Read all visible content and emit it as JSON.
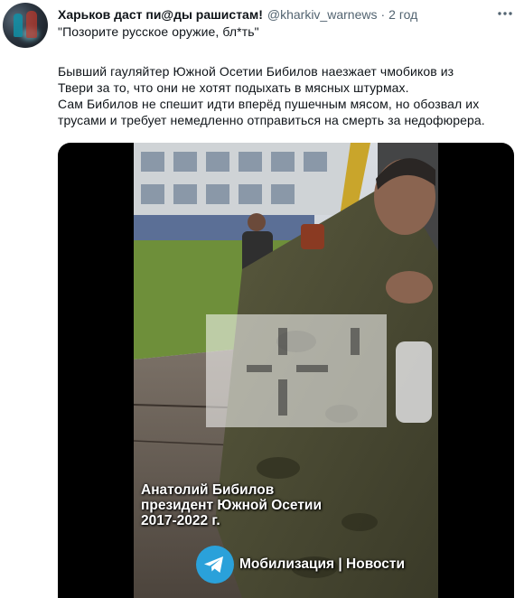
{
  "tweet": {
    "display_name": "Харьков даст пи@ды рашистам!",
    "handle": "@kharkiv_warnews",
    "separator": "·",
    "time": "2 год",
    "lines": [
      "\"Позорите русское оружие, бл*ть\"",
      "Бывший гауляйтер Южной Осетии Бибилов наезжает чмобиков из",
      "Твери за то, что они не хотят подыхать в мясных штурмах.",
      "Сам Бибилов не спешит идти вперёд пушечным мясом, но обозвал их",
      "трусами и требует немедленно отправиться на смерть за недофюрера."
    ]
  },
  "video": {
    "caption_lines": [
      "Анатолий Бибилов",
      "президент Южной Осетии",
      "2017-2022 г."
    ],
    "watermark_text": "Мобилизация | Новости"
  },
  "icons": {
    "more": "more-options-icon",
    "telegram": "telegram-icon",
    "logo": "channel-logo-watermark"
  },
  "colors": {
    "text_primary": "#0f1419",
    "text_secondary": "#536471",
    "media_background": "#000000",
    "telegram_blue": "#2aa1da"
  }
}
